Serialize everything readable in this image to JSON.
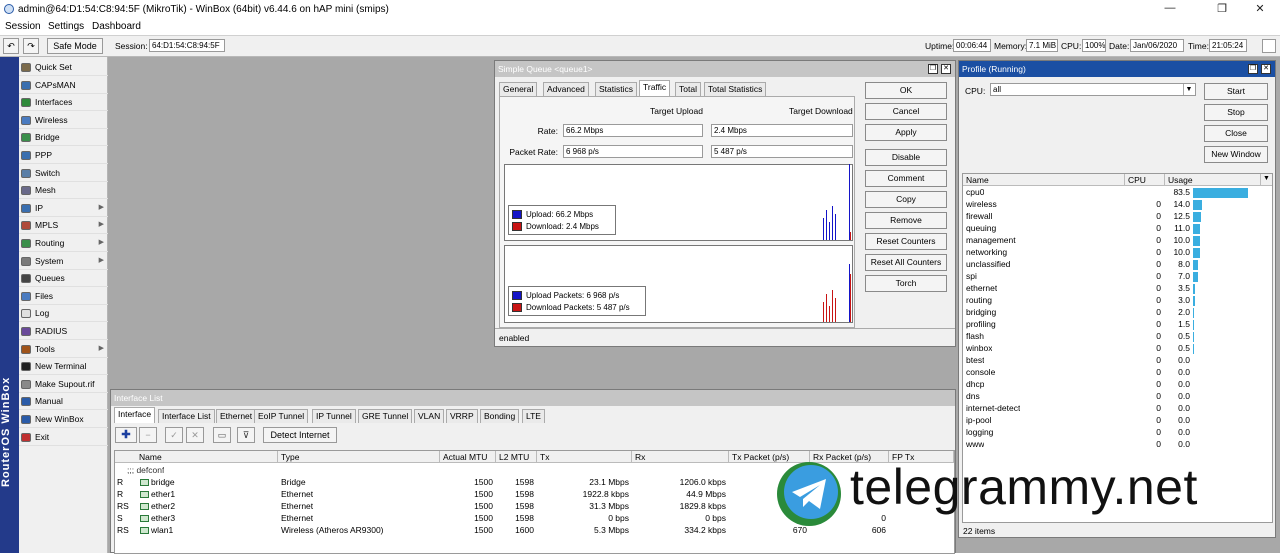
{
  "window": {
    "title": "admin@64:D1:54:C8:94:5F (MikroTik) - WinBox (64bit) v6.44.6 on hAP mini (smips)",
    "controls": [
      "—",
      "❐",
      "✕"
    ]
  },
  "menubar": [
    "Session",
    "Settings",
    "Dashboard"
  ],
  "toolbar": {
    "undo": "↶",
    "redo": "↷",
    "safe_mode": "Safe Mode",
    "session_label": "Session:",
    "session_value": "64:D1:54:C8:94:5F",
    "uptime_label": "Uptime:",
    "uptime_value": "00:06:44",
    "memory_label": "Memory:",
    "memory_value": "7.1 MiB",
    "cpu_label": "CPU:",
    "cpu_value": "100%",
    "date_label": "Date:",
    "date_value": "Jan/06/2020",
    "time_label": "Time:",
    "time_value": "21:05:24"
  },
  "sidebar": {
    "vertical_text": "RouterOS WinBox",
    "items": [
      {
        "label": "Quick Set",
        "icon": "quick-set-icon",
        "color": "#7b6a4a",
        "arrow": ""
      },
      {
        "label": "CAPsMAN",
        "icon": "capsman-icon",
        "color": "#3a6fb0",
        "arrow": ""
      },
      {
        "label": "Interfaces",
        "icon": "interfaces-icon",
        "color": "#2f8a3a",
        "arrow": ""
      },
      {
        "label": "Wireless",
        "icon": "wireless-icon",
        "color": "#4a7bc0",
        "arrow": ""
      },
      {
        "label": "Bridge",
        "icon": "bridge-icon",
        "color": "#3a8f4a",
        "arrow": ""
      },
      {
        "label": "PPP",
        "icon": "ppp-icon",
        "color": "#3a6fb0",
        "arrow": ""
      },
      {
        "label": "Switch",
        "icon": "switch-icon",
        "color": "#5a7fa8",
        "arrow": ""
      },
      {
        "label": "Mesh",
        "icon": "mesh-icon",
        "color": "#6a6a8a",
        "arrow": ""
      },
      {
        "label": "IP",
        "icon": "ip-icon",
        "color": "#3a6fb0",
        "arrow": "▶"
      },
      {
        "label": "MPLS",
        "icon": "mpls-icon",
        "color": "#b04a3a",
        "arrow": "▶"
      },
      {
        "label": "Routing",
        "icon": "routing-icon",
        "color": "#3a8f4a",
        "arrow": "▶"
      },
      {
        "label": "System",
        "icon": "system-icon",
        "color": "#7a7a7a",
        "arrow": "▶"
      },
      {
        "label": "Queues",
        "icon": "queues-icon",
        "color": "#444444",
        "arrow": ""
      },
      {
        "label": "Files",
        "icon": "files-icon",
        "color": "#4a7bc0",
        "arrow": ""
      },
      {
        "label": "Log",
        "icon": "log-icon",
        "color": "#e0e0e0",
        "arrow": ""
      },
      {
        "label": "RADIUS",
        "icon": "radius-icon",
        "color": "#6a4a9a",
        "arrow": ""
      },
      {
        "label": "Tools",
        "icon": "tools-icon",
        "color": "#a0541a",
        "arrow": "▶"
      },
      {
        "label": "New Terminal",
        "icon": "terminal-icon",
        "color": "#222222",
        "arrow": ""
      },
      {
        "label": "Make Supout.rif",
        "icon": "supout-icon",
        "color": "#8a8a8a",
        "arrow": ""
      },
      {
        "label": "Manual",
        "icon": "manual-icon",
        "color": "#2a5ba8",
        "arrow": ""
      },
      {
        "label": "New WinBox",
        "icon": "winbox-icon",
        "color": "#2a5ba8",
        "arrow": ""
      },
      {
        "label": "Exit",
        "icon": "exit-icon",
        "color": "#c03030",
        "arrow": ""
      }
    ]
  },
  "queue_window": {
    "title": "Simple Queue <queue1>",
    "tabs": [
      "General",
      "Advanced",
      "Statistics",
      "Traffic",
      "Total",
      "Total Statistics"
    ],
    "col_upload": "Target Upload",
    "col_download": "Target Download",
    "rate_label": "Rate:",
    "rate_upload": "66.2 Mbps",
    "rate_download": "2.4 Mbps",
    "packet_label": "Packet Rate:",
    "packet_upload": "6 968 p/s",
    "packet_download": "5 487 p/s",
    "legend1": [
      "Upload:  66.2 Mbps",
      "Download:  2.4 Mbps"
    ],
    "legend2": [
      "Upload Packets:  6 968 p/s",
      "Download Packets:  5 487 p/s"
    ],
    "upload_color": "#1414c8",
    "download_color": "#c81414",
    "buttons": [
      "OK",
      "Cancel",
      "Apply",
      "Disable",
      "Comment",
      "Copy",
      "Remove",
      "Reset Counters",
      "Reset All Counters",
      "Torch"
    ],
    "status": "enabled"
  },
  "profile_window": {
    "title": "Profile (Running)",
    "cpu_label": "CPU:",
    "cpu_value": "all",
    "buttons": [
      "Start",
      "Stop",
      "Close",
      "New Window"
    ],
    "columns": [
      "Name",
      "CPU",
      "Usage"
    ],
    "rows": [
      {
        "name": "cpu0",
        "cpu": "",
        "usage": "83.5",
        "pct": 83.5
      },
      {
        "name": "wireless",
        "cpu": "0",
        "usage": "14.0",
        "pct": 14.0
      },
      {
        "name": "firewall",
        "cpu": "0",
        "usage": "12.5",
        "pct": 12.5
      },
      {
        "name": "queuing",
        "cpu": "0",
        "usage": "11.0",
        "pct": 11.0
      },
      {
        "name": "management",
        "cpu": "0",
        "usage": "10.0",
        "pct": 10.0
      },
      {
        "name": "networking",
        "cpu": "0",
        "usage": "10.0",
        "pct": 10.0
      },
      {
        "name": "unclassified",
        "cpu": "0",
        "usage": "8.0",
        "pct": 8.0
      },
      {
        "name": "spi",
        "cpu": "0",
        "usage": "7.0",
        "pct": 7.0
      },
      {
        "name": "ethernet",
        "cpu": "0",
        "usage": "3.5",
        "pct": 3.5
      },
      {
        "name": "routing",
        "cpu": "0",
        "usage": "3.0",
        "pct": 3.0
      },
      {
        "name": "bridging",
        "cpu": "0",
        "usage": "2.0",
        "pct": 2.0
      },
      {
        "name": "profiling",
        "cpu": "0",
        "usage": "1.5",
        "pct": 1.5
      },
      {
        "name": "flash",
        "cpu": "0",
        "usage": "0.5",
        "pct": 0.5
      },
      {
        "name": "winbox",
        "cpu": "0",
        "usage": "0.5",
        "pct": 0.5
      },
      {
        "name": "btest",
        "cpu": "0",
        "usage": "0.0",
        "pct": 0
      },
      {
        "name": "console",
        "cpu": "0",
        "usage": "0.0",
        "pct": 0
      },
      {
        "name": "dhcp",
        "cpu": "0",
        "usage": "0.0",
        "pct": 0
      },
      {
        "name": "dns",
        "cpu": "0",
        "usage": "0.0",
        "pct": 0
      },
      {
        "name": "internet-detect",
        "cpu": "0",
        "usage": "0.0",
        "pct": 0
      },
      {
        "name": "ip-pool",
        "cpu": "0",
        "usage": "0.0",
        "pct": 0
      },
      {
        "name": "logging",
        "cpu": "0",
        "usage": "0.0",
        "pct": 0
      },
      {
        "name": "www",
        "cpu": "0",
        "usage": "0.0",
        "pct": 0
      }
    ],
    "bar_color": "#3aaee0",
    "count": "22 items"
  },
  "interface_window": {
    "title": "Interface List",
    "tabs": [
      "Interface",
      "Interface List",
      "Ethernet",
      "EoIP Tunnel",
      "IP Tunnel",
      "GRE Tunnel",
      "VLAN",
      "VRRP",
      "Bonding",
      "LTE"
    ],
    "detect_button": "Detect Internet",
    "columns": [
      "Name",
      "Type",
      "Actual MTU",
      "L2 MTU",
      "Tx",
      "Rx",
      "Tx Packet (p/s)",
      "Rx Packet (p/s)",
      "FP Tx"
    ],
    "group": ";;; defconf",
    "rows": [
      {
        "flag": "R",
        "name": "bridge",
        "type": "Bridge",
        "mtu": "1500",
        "l2mtu": "1598",
        "tx": "23.1 Mbps",
        "rx": "1206.0 kbps",
        "txp": "",
        "rxp": ""
      },
      {
        "flag": "R",
        "name": "ether1",
        "type": "Ethernet",
        "mtu": "1500",
        "l2mtu": "1598",
        "tx": "1922.8 kbps",
        "rx": "44.9 Mbps",
        "txp": "",
        "rxp": ""
      },
      {
        "flag": "RS",
        "name": "ether2",
        "type": "Ethernet",
        "mtu": "1500",
        "l2mtu": "1598",
        "tx": "31.3 Mbps",
        "rx": "1829.8 kbps",
        "txp": "",
        "rxp": ""
      },
      {
        "flag": "S",
        "name": "ether3",
        "type": "Ethernet",
        "mtu": "1500",
        "l2mtu": "1598",
        "tx": "0 bps",
        "rx": "0 bps",
        "txp": "",
        "rxp": "0"
      },
      {
        "flag": "RS",
        "name": "wlan1",
        "type": "Wireless (Atheros AR9300)",
        "mtu": "1500",
        "l2mtu": "1600",
        "tx": "5.3 Mbps",
        "rx": "334.2 kbps",
        "txp": "670",
        "rxp": "606"
      }
    ]
  },
  "watermark": {
    "text": "telegrammy.net",
    "logo": "telegram-logo"
  }
}
